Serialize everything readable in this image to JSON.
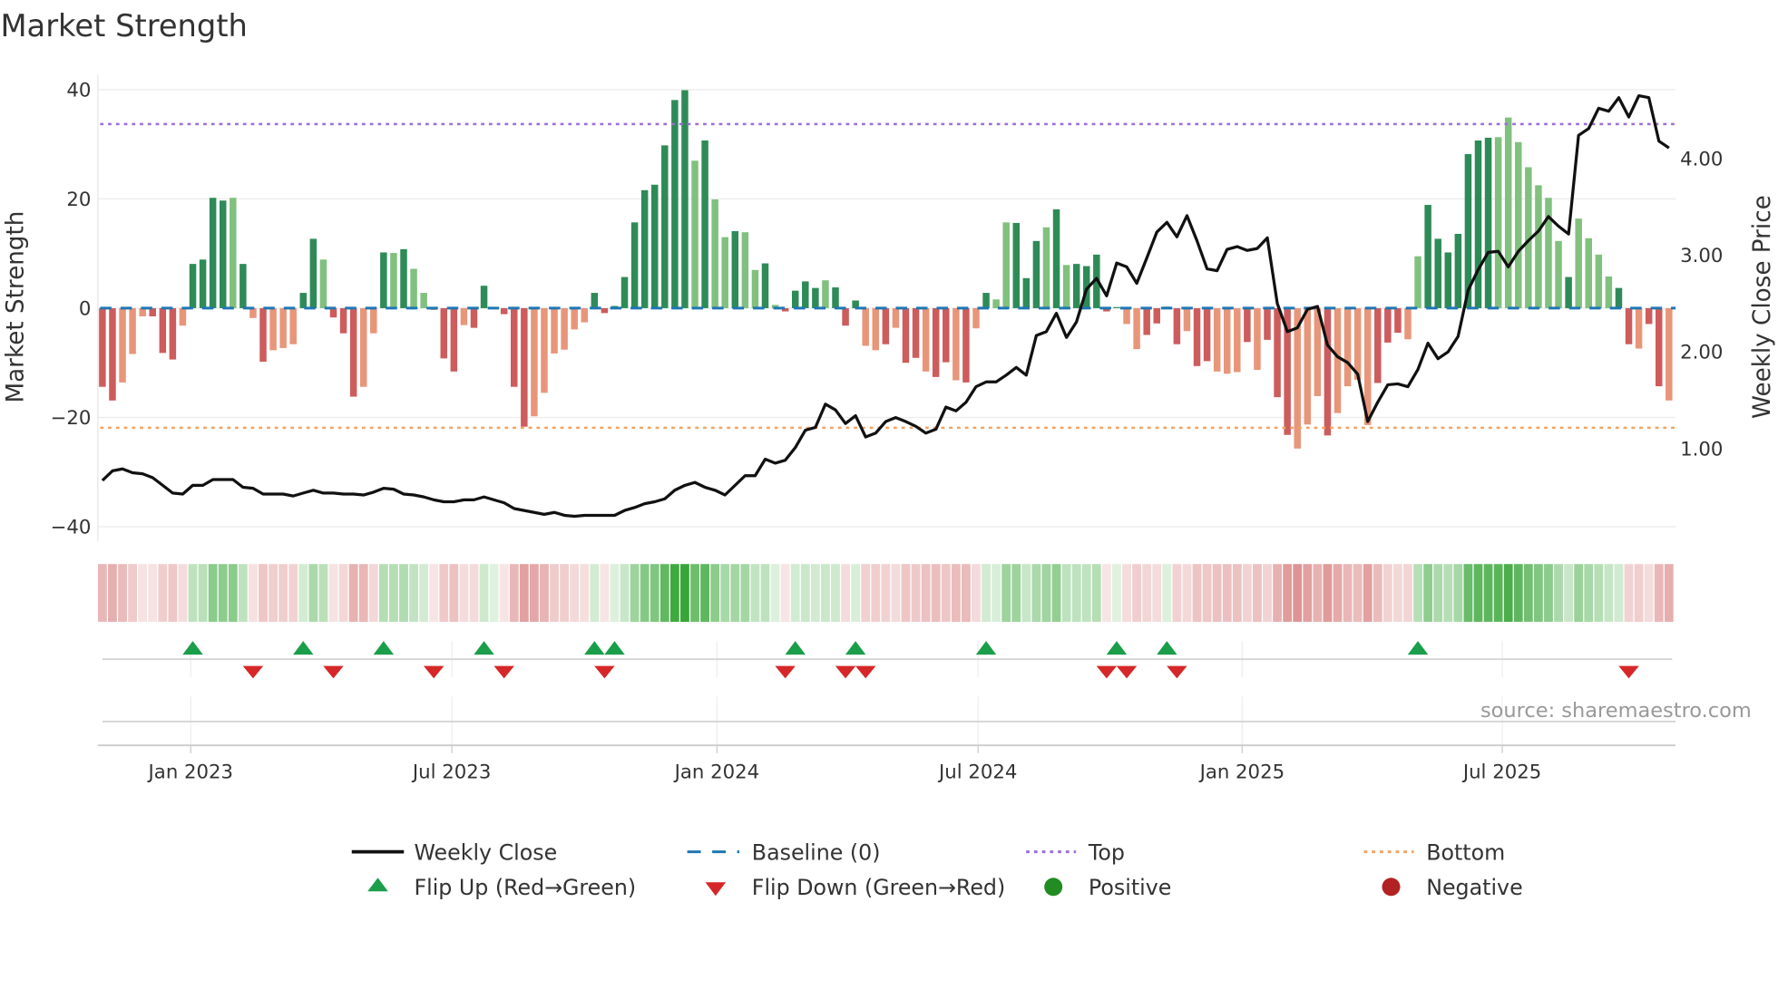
{
  "title": "Market Strength",
  "source": "source: sharemaestro.com",
  "colors": {
    "green_dark": "#2e8b57",
    "green_light": "#81c07f",
    "red_dark": "#cd5c5c",
    "red_light": "#e8967a",
    "close_line": "#111111",
    "baseline": "#1f77b4",
    "top": "#9b6ddb",
    "bottom": "#f4a261",
    "flip_up": "#1a9e4a",
    "flip_down": "#d62728",
    "positive": "#228b22",
    "negative": "#b22222",
    "heat_green": "44,160,44",
    "heat_red": "205,92,92"
  },
  "chart_data": {
    "type": "bar",
    "title": "Market Strength",
    "xlabel": "",
    "ylabel": "Market Strength",
    "y2label": "Weekly Close Price",
    "ylim": [
      -42.7,
      41.9
    ],
    "y2lim": [
      0.04,
      4.82
    ],
    "grid": true,
    "legend_position": "bottom",
    "yticks": [
      {
        "value": 40,
        "label": "40"
      },
      {
        "value": 20,
        "label": "20"
      },
      {
        "value": 0,
        "label": "0"
      },
      {
        "value": -20,
        "label": "−20"
      },
      {
        "value": -40,
        "label": "−40"
      }
    ],
    "y2ticks": [
      {
        "value": 4,
        "label": "4.00"
      },
      {
        "value": 3,
        "label": "3.00"
      },
      {
        "value": 2,
        "label": "2.00"
      },
      {
        "value": 1,
        "label": "1.00"
      }
    ],
    "xticks": [
      {
        "index": 8.8,
        "label": "Jan 2023"
      },
      {
        "index": 34.8,
        "label": "Jul 2023"
      },
      {
        "index": 61.2,
        "label": "Jan 2024"
      },
      {
        "index": 87.2,
        "label": "Jul 2024"
      },
      {
        "index": 113.5,
        "label": "Jan 2025"
      },
      {
        "index": 139.4,
        "label": "Jul 2025"
      }
    ],
    "baseline": 0,
    "top": 33.7,
    "bottom": -21.9,
    "strength": [
      -14.4,
      -16.9,
      -13.6,
      -8.4,
      -1.5,
      -1.5,
      -8.2,
      -9.4,
      -3.2,
      8.1,
      8.9,
      20.2,
      19.7,
      20.2,
      8.1,
      -1.8,
      -9.8,
      -7.7,
      -7.3,
      -6.6,
      2.8,
      12.7,
      8.9,
      -1.7,
      -4.6,
      -16.2,
      -14.4,
      -4.6,
      10.2,
      10.1,
      10.8,
      7.2,
      2.8,
      -0.3,
      -9.2,
      -11.6,
      -3.1,
      -3.6,
      4.1,
      0.2,
      -1.1,
      -14.4,
      -21.7,
      -19.8,
      -15.5,
      -8.3,
      -7.6,
      -3.9,
      -2.6,
      2.8,
      -0.9,
      0.4,
      5.7,
      15.7,
      21.6,
      22.6,
      29.8,
      38.1,
      39.9,
      27.0,
      30.7,
      19.9,
      13.0,
      14.1,
      13.9,
      7.0,
      8.2,
      0.6,
      -0.6,
      3.2,
      4.9,
      3.7,
      5.1,
      3.8,
      -3.2,
      1.4,
      -6.9,
      -7.7,
      -6.6,
      -3.6,
      -10.0,
      -9.1,
      -11.6,
      -12.6,
      -9.9,
      -13.2,
      -13.6,
      -3.7,
      2.8,
      1.6,
      15.7,
      15.6,
      5.5,
      12.3,
      14.8,
      18.1,
      7.9,
      8.1,
      7.7,
      9.8,
      -0.6,
      0.2,
      -2.9,
      -7.5,
      -4.9,
      -2.8,
      0.3,
      -6.6,
      -4.2,
      -10.6,
      -9.7,
      -11.6,
      -12.0,
      -11.7,
      -6.2,
      -11.3,
      -5.8,
      -16.3,
      -23.2,
      -25.7,
      -21.3,
      -16.1,
      -23.3,
      -19.2,
      -14.3,
      -13.1,
      -21.4,
      -13.7,
      -6.3,
      -4.5,
      -5.7,
      9.5,
      18.9,
      12.7,
      10.2,
      13.6,
      28.2,
      30.7,
      31.2,
      31.3,
      34.9,
      30.4,
      25.8,
      22.5,
      20.2,
      12.3,
      5.7,
      16.4,
      12.8,
      9.8,
      5.8,
      3.7,
      -6.6,
      -7.4,
      -2.9,
      -14.3,
      -16.9
    ],
    "shade": "ddllldddlddddldldlllddldddlldldlldddlddldddllllllddddddddddldlldlldlddddldddlldlddlddldldlldddldldddddllddldlddllldldddllldlllldddlldddddddllllllldllllddldd",
    "close": [
      0.67,
      0.77,
      0.79,
      0.75,
      0.74,
      0.7,
      0.62,
      0.54,
      0.53,
      0.62,
      0.62,
      0.68,
      0.68,
      0.68,
      0.6,
      0.59,
      0.53,
      0.53,
      0.53,
      0.51,
      0.54,
      0.57,
      0.54,
      0.54,
      0.53,
      0.53,
      0.52,
      0.55,
      0.59,
      0.58,
      0.53,
      0.52,
      0.5,
      0.47,
      0.45,
      0.45,
      0.47,
      0.47,
      0.5,
      0.47,
      0.44,
      0.38,
      0.36,
      0.34,
      0.32,
      0.34,
      0.31,
      0.3,
      0.31,
      0.31,
      0.31,
      0.31,
      0.36,
      0.39,
      0.43,
      0.45,
      0.48,
      0.57,
      0.62,
      0.65,
      0.6,
      0.57,
      0.52,
      0.62,
      0.72,
      0.72,
      0.89,
      0.85,
      0.88,
      1.01,
      1.19,
      1.22,
      1.46,
      1.4,
      1.26,
      1.34,
      1.12,
      1.16,
      1.28,
      1.32,
      1.28,
      1.23,
      1.16,
      1.2,
      1.43,
      1.39,
      1.48,
      1.64,
      1.69,
      1.69,
      1.76,
      1.84,
      1.76,
      2.17,
      2.21,
      2.4,
      2.15,
      2.31,
      2.65,
      2.76,
      2.58,
      2.92,
      2.88,
      2.71,
      2.97,
      3.24,
      3.34,
      3.19,
      3.41,
      3.15,
      2.86,
      2.84,
      3.06,
      3.09,
      3.05,
      3.07,
      3.18,
      2.5,
      2.21,
      2.25,
      2.44,
      2.47,
      2.07,
      1.95,
      1.89,
      1.77,
      1.28,
      1.48,
      1.66,
      1.67,
      1.64,
      1.82,
      2.09,
      1.93,
      2.0,
      2.16,
      2.64,
      2.85,
      3.03,
      3.04,
      2.88,
      3.04,
      3.15,
      3.25,
      3.4,
      3.3,
      3.22,
      4.24,
      4.31,
      4.52,
      4.49,
      4.63,
      4.43,
      4.65,
      4.63,
      4.18,
      4.11
    ],
    "flip_up": [
      9,
      20,
      28,
      38,
      49,
      51,
      69,
      75,
      88,
      101,
      106,
      131
    ],
    "flip_down": [
      15,
      23,
      33,
      40,
      50,
      68,
      74,
      76,
      100,
      102,
      107,
      152
    ],
    "legend": [
      {
        "kind": "line",
        "label": "Weekly Close"
      },
      {
        "kind": "dash",
        "label": "Baseline (0)"
      },
      {
        "kind": "top",
        "label": "Top"
      },
      {
        "kind": "bottom",
        "label": "Bottom"
      },
      {
        "kind": "up",
        "label": "Flip Up (Red→Green)"
      },
      {
        "kind": "down",
        "label": "Flip Down (Green→Red)"
      },
      {
        "kind": "pos",
        "label": "Positive"
      },
      {
        "kind": "neg",
        "label": "Negative"
      }
    ]
  }
}
